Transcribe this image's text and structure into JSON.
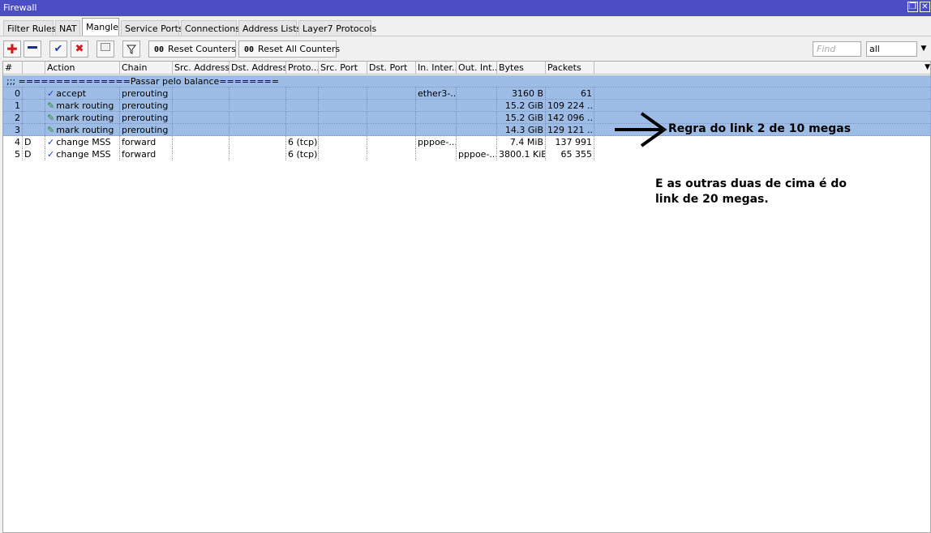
{
  "window": {
    "title": "Firewall",
    "restore_glyph": "❐",
    "close_glyph": "✕"
  },
  "tabs": [
    {
      "label": "Filter Rules"
    },
    {
      "label": "NAT"
    },
    {
      "label": "Mangle"
    },
    {
      "label": "Service Ports"
    },
    {
      "label": "Connections"
    },
    {
      "label": "Address Lists"
    },
    {
      "label": "Layer7 Protocols"
    }
  ],
  "toolbar": {
    "reset_counters": "Reset Counters",
    "reset_all_counters": "Reset All Counters",
    "counter_glyph": "00",
    "find_placeholder": "Find",
    "filter_value": "all"
  },
  "columns": [
    "#",
    "",
    "Action",
    "Chain",
    "Src. Address",
    "Dst. Address",
    "Proto...",
    "Src. Port",
    "Dst. Port",
    "In. Inter...",
    "Out. Int...",
    "Bytes",
    "Packets"
  ],
  "comment_row": ";;; ===============Passar pelo balance========",
  "rows": [
    {
      "num": "0",
      "flag": "",
      "action": "accept",
      "chain": "prerouting",
      "proto": "",
      "in_iface": "ether3-...",
      "out_iface": "",
      "bytes": "3160 B",
      "packets": "61"
    },
    {
      "num": "1",
      "flag": "",
      "action": "mark routing",
      "chain": "prerouting",
      "proto": "",
      "in_iface": "",
      "out_iface": "",
      "bytes": "15.2 GiB",
      "packets": "109 224 ..."
    },
    {
      "num": "2",
      "flag": "",
      "action": "mark routing",
      "chain": "prerouting",
      "proto": "",
      "in_iface": "",
      "out_iface": "",
      "bytes": "15.2 GiB",
      "packets": "142 096 ..."
    },
    {
      "num": "3",
      "flag": "",
      "action": "mark routing",
      "chain": "prerouting",
      "proto": "",
      "in_iface": "",
      "out_iface": "",
      "bytes": "14.3 GiB",
      "packets": "129 121 ..."
    },
    {
      "num": "4",
      "flag": "D",
      "action": "change MSS",
      "chain": "forward",
      "proto": "6 (tcp)",
      "in_iface": "pppoe-...",
      "out_iface": "",
      "bytes": "7.4 MiB",
      "packets": "137 991"
    },
    {
      "num": "5",
      "flag": "D",
      "action": "change MSS",
      "chain": "forward",
      "proto": "6 (tcp)",
      "in_iface": "",
      "out_iface": "pppoe-...",
      "bytes": "3800.1 KiB",
      "packets": "65 355"
    }
  ],
  "annotations": {
    "note1": "Regra do link 2 de 10 megas",
    "note2": "E as outras duas de cima é do link de 20 megas."
  },
  "icons": {
    "add": "plus-icon",
    "remove": "minus-icon",
    "enable": "check-icon",
    "disable": "x-icon",
    "comment": "note-icon",
    "filter": "funnel-icon"
  },
  "colors": {
    "titlebar": "#4c4fc4",
    "selection": "#9ebde6",
    "check": "#1a3fb0",
    "pencil": "#2e8b2e",
    "add_icon": "#d11a1a",
    "remove_icon": "#1a2f8c"
  }
}
